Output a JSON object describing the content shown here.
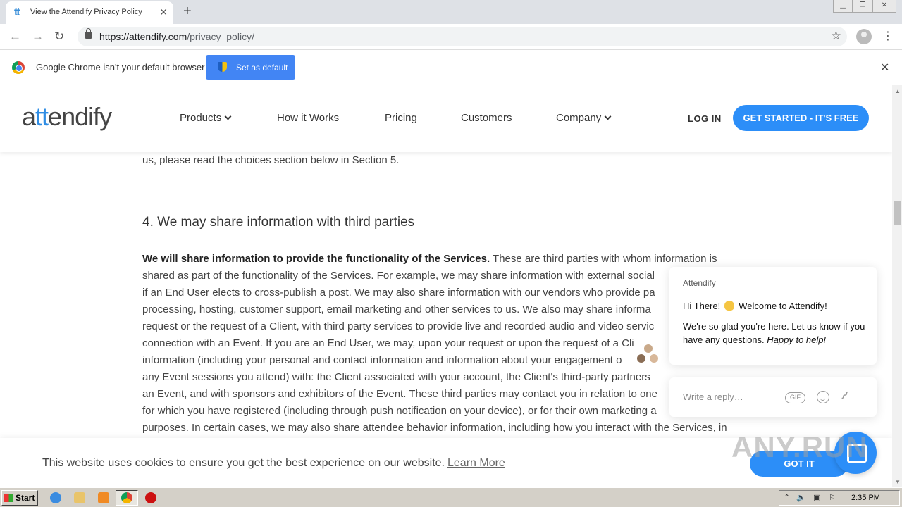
{
  "browser": {
    "tab_title": "View the Attendify Privacy Policy",
    "tab_favicon": "tt",
    "url_host": "https://attendify.com",
    "url_path": "/privacy_policy/"
  },
  "infobar": {
    "message": "Google Chrome isn't your default browser",
    "button_label": "Set as default"
  },
  "site": {
    "logo_prefix": "a",
    "logo_tt": "tt",
    "logo_suffix": "endify",
    "nav": {
      "products": "Products",
      "how_it_works": "How it Works",
      "pricing": "Pricing",
      "customers": "Customers",
      "company": "Company"
    },
    "login": "LOG IN",
    "cta": "GET STARTED - IT'S FREE"
  },
  "content": {
    "top_line": "us, please read the choices section below in Section 5.",
    "heading": "4. We may share information with third parties",
    "lead_bold": "We will share information to provide the functionality of the Services.",
    "lines": [
      " These are third parties with whom information is",
      "shared as part of the functionality of the Services. For example, we may share information with external social",
      "if an End User elects to cross-publish a post. We may also share information with our vendors who provide pa",
      "processing, hosting, customer support, email marketing and other services to us. We also may share informa",
      "request or the request of a Client, with third party services to provide live and recorded audio and video servic",
      "connection with an Event. If you are an End User, we may, upon your request or upon the request of a Cli",
      "information (including your personal and contact information and information about your engagement o",
      "any Event sessions you attend) with: the Client associated with your account, the Client's third-party partners",
      "an Event, and with sponsors and exhibitors of the Event. These third parties may contact you in relation to one",
      "for which you have registered (including through push notification on your device), or for their own marketing a",
      "purposes. In certain cases, we may also share attendee behavior information, including how you interact with the Services, in"
    ]
  },
  "chat": {
    "sender": "Attendify",
    "greeting_start": "Hi There!",
    "greeting_end": "Welcome to Attendify!",
    "message": "We're so glad you're here. Let us know if you have any questions.",
    "message_italic": "Happy to help!",
    "reply_placeholder": "Write a reply…",
    "gif_label": "GIF"
  },
  "cookie": {
    "text": "This website uses cookies to ensure you get the best experience on our website.",
    "learn_more": "Learn More",
    "button": "GOT IT"
  },
  "watermark": "ANY.RUN",
  "taskbar": {
    "start": "Start",
    "time": "2:35 PM"
  },
  "colors": {
    "brand_blue": "#2c8ef8",
    "chrome_blue": "#4285f4"
  },
  "icons": [
    "tab-favicon",
    "close-icon",
    "plus-icon",
    "back-icon",
    "forward-icon",
    "reload-icon",
    "lock-icon",
    "star-icon",
    "profile-icon",
    "menu-icon",
    "chrome-logo-icon",
    "shield-icon",
    "chevron-down-icon",
    "emoji-icon",
    "attach-icon",
    "chat-launcher-icon"
  ]
}
